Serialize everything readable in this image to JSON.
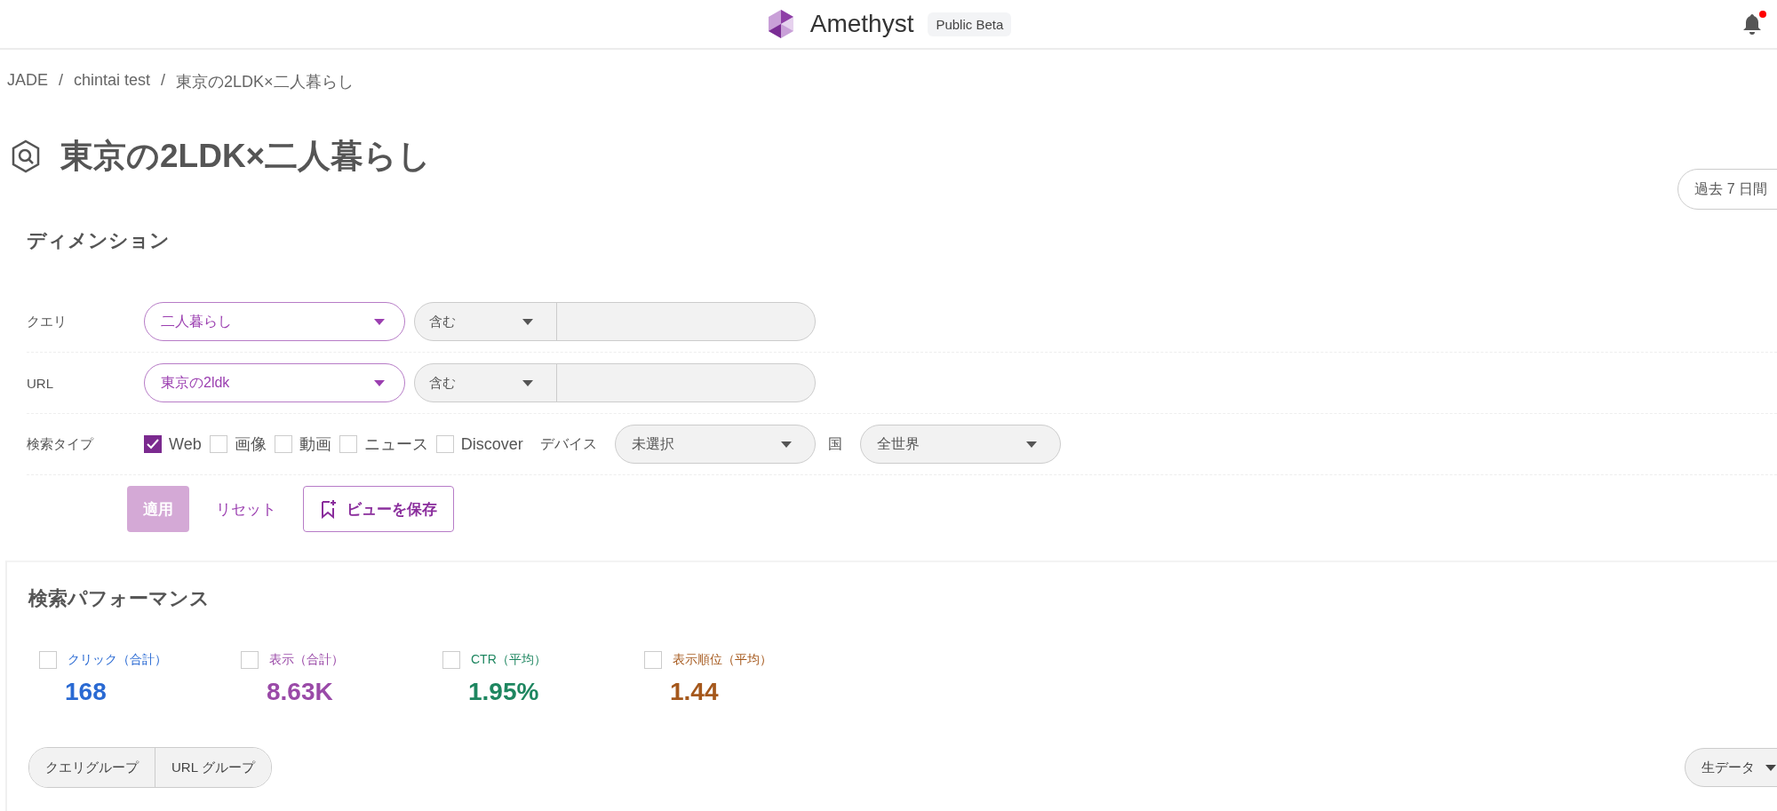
{
  "header": {
    "brand": "Amethyst",
    "badge": "Public Beta",
    "notification_unread": true
  },
  "breadcrumb": [
    {
      "label": "JADE"
    },
    {
      "separator": "/",
      "label": "chintai test"
    },
    {
      "separator": "/",
      "label": "東京の2LDK×二人暮らし"
    }
  ],
  "title": "東京の2LDK×二人暮らし",
  "date_range": "過去 7 日間",
  "dimensions": {
    "heading": "ディメンション",
    "filters": [
      {
        "label": "クエリ",
        "value": "二人暮らし",
        "operator": "含む"
      },
      {
        "label": "URL",
        "value": "東京の2ldk",
        "operator": "含む"
      }
    ],
    "search_type": {
      "label": "検索タイプ",
      "options": [
        {
          "label": "Web",
          "checked": true
        },
        {
          "label": "画像",
          "checked": false
        },
        {
          "label": "動画",
          "checked": false
        },
        {
          "label": "ニュース",
          "checked": false
        },
        {
          "label": "Discover",
          "checked": false
        }
      ]
    },
    "device": {
      "label": "デバイス",
      "value": "未選択"
    },
    "country": {
      "label": "国",
      "value": "全世界"
    }
  },
  "actions": [
    {
      "kind": "primary",
      "label": "適用",
      "disabled": true
    },
    {
      "kind": "link",
      "label": "リセット"
    },
    {
      "kind": "outline",
      "label": "ビューを保存"
    }
  ],
  "performance": {
    "heading": "検索パフォーマンス",
    "metrics": [
      {
        "label": "クリック（合計）",
        "value": "168",
        "checked": false,
        "color": "#2a6ad3"
      },
      {
        "label": "表示（合計）",
        "value": "8.63K",
        "checked": false,
        "color": "#9a4aa8"
      },
      {
        "label": "CTR（平均）",
        "value": "1.95%",
        "checked": false,
        "color": "#1e8660"
      },
      {
        "label": "表示順位（平均）",
        "value": "1.44",
        "checked": false,
        "color": "#a5581c"
      }
    ],
    "groups": [
      {
        "label": "クエリグループ",
        "selected": false
      },
      {
        "label": "URL グループ",
        "selected": false
      }
    ],
    "view_mode": "生データ"
  }
}
